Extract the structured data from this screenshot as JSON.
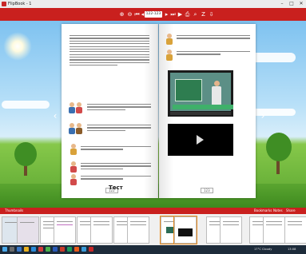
{
  "window": {
    "title": "FlipBook - 1",
    "minimize": "–",
    "maximize": "□",
    "close": "✕"
  },
  "toolbar": {
    "page_indicator": "122-123",
    "icons": [
      "zoom-in-icon",
      "zoom-out-icon",
      "first-page-icon",
      "previous-page-icon",
      "page-input",
      "next-page-icon",
      "last-page-icon",
      "autoplay-icon",
      "print-icon",
      "search-icon",
      "text-icon",
      "download-icon"
    ]
  },
  "book": {
    "left_page_number": "122",
    "right_page_number": "123",
    "test_label": "Тест"
  },
  "thumbbar": {
    "left_label": "Thumbnails",
    "right_labels": [
      "Bookmarks",
      "Notes",
      "Share"
    ]
  },
  "taskbar": {
    "weather": "17°C Cloudy",
    "time": "13:08"
  }
}
